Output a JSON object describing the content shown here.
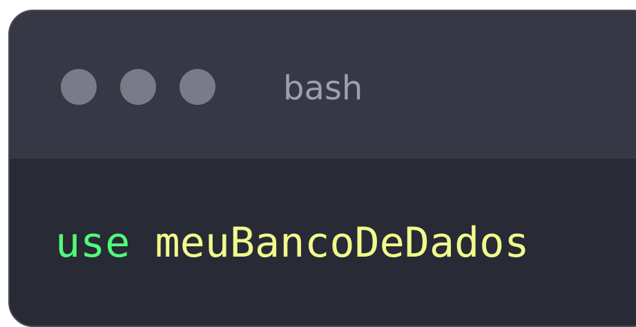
{
  "window": {
    "title": "bash",
    "controls": [
      "close",
      "minimize",
      "maximize"
    ]
  },
  "terminal": {
    "command": "use",
    "argument": "meuBancoDeDados"
  },
  "colors": {
    "titlebar": "#363845",
    "body": "#282a36",
    "dot": "#797b88",
    "title_text": "#9ea0b2",
    "keyword": "#50fa7b",
    "argument": "#f1fa8c"
  }
}
